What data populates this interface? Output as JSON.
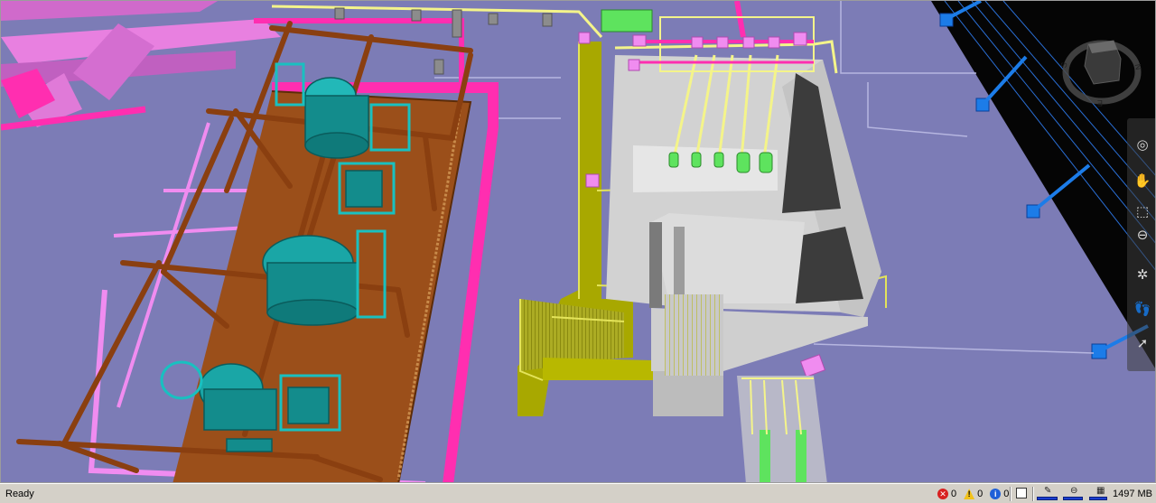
{
  "status": {
    "text": "Ready",
    "errors": "0",
    "warnings": "0",
    "info": "0",
    "messages": "0",
    "memory": "1497 MB",
    "meter_levels": [
      0.95,
      0.9,
      0.85
    ]
  },
  "viewcube": {
    "compass_s": "S",
    "compass_n": "N",
    "compass_e": "E"
  },
  "nav_tools": [
    {
      "name": "steering-wheel-icon",
      "glyph": "◎"
    },
    {
      "name": "pan-hand-icon",
      "glyph": "✋"
    },
    {
      "name": "zoom-window-icon",
      "glyph": "⬚"
    },
    {
      "name": "zoom-icon",
      "glyph": "⊖"
    },
    {
      "name": "orbit-icon",
      "glyph": "✲"
    },
    {
      "name": "walk-icon",
      "glyph": "👣"
    },
    {
      "name": "select-icon",
      "glyph": "➚"
    }
  ],
  "colors": {
    "background": "#7c7cb6",
    "steel": "#9b4f1a",
    "equipment": "#19a0a0",
    "platform": "#b8b800",
    "pipe_yellow": "#f4f48a",
    "pipe_magenta": "#ff2eb0",
    "pipe_pink": "#f08cf0",
    "concrete": "#d2d2d2",
    "valve_green": "#5ee35e",
    "blue_support": "#1c7ce8"
  }
}
